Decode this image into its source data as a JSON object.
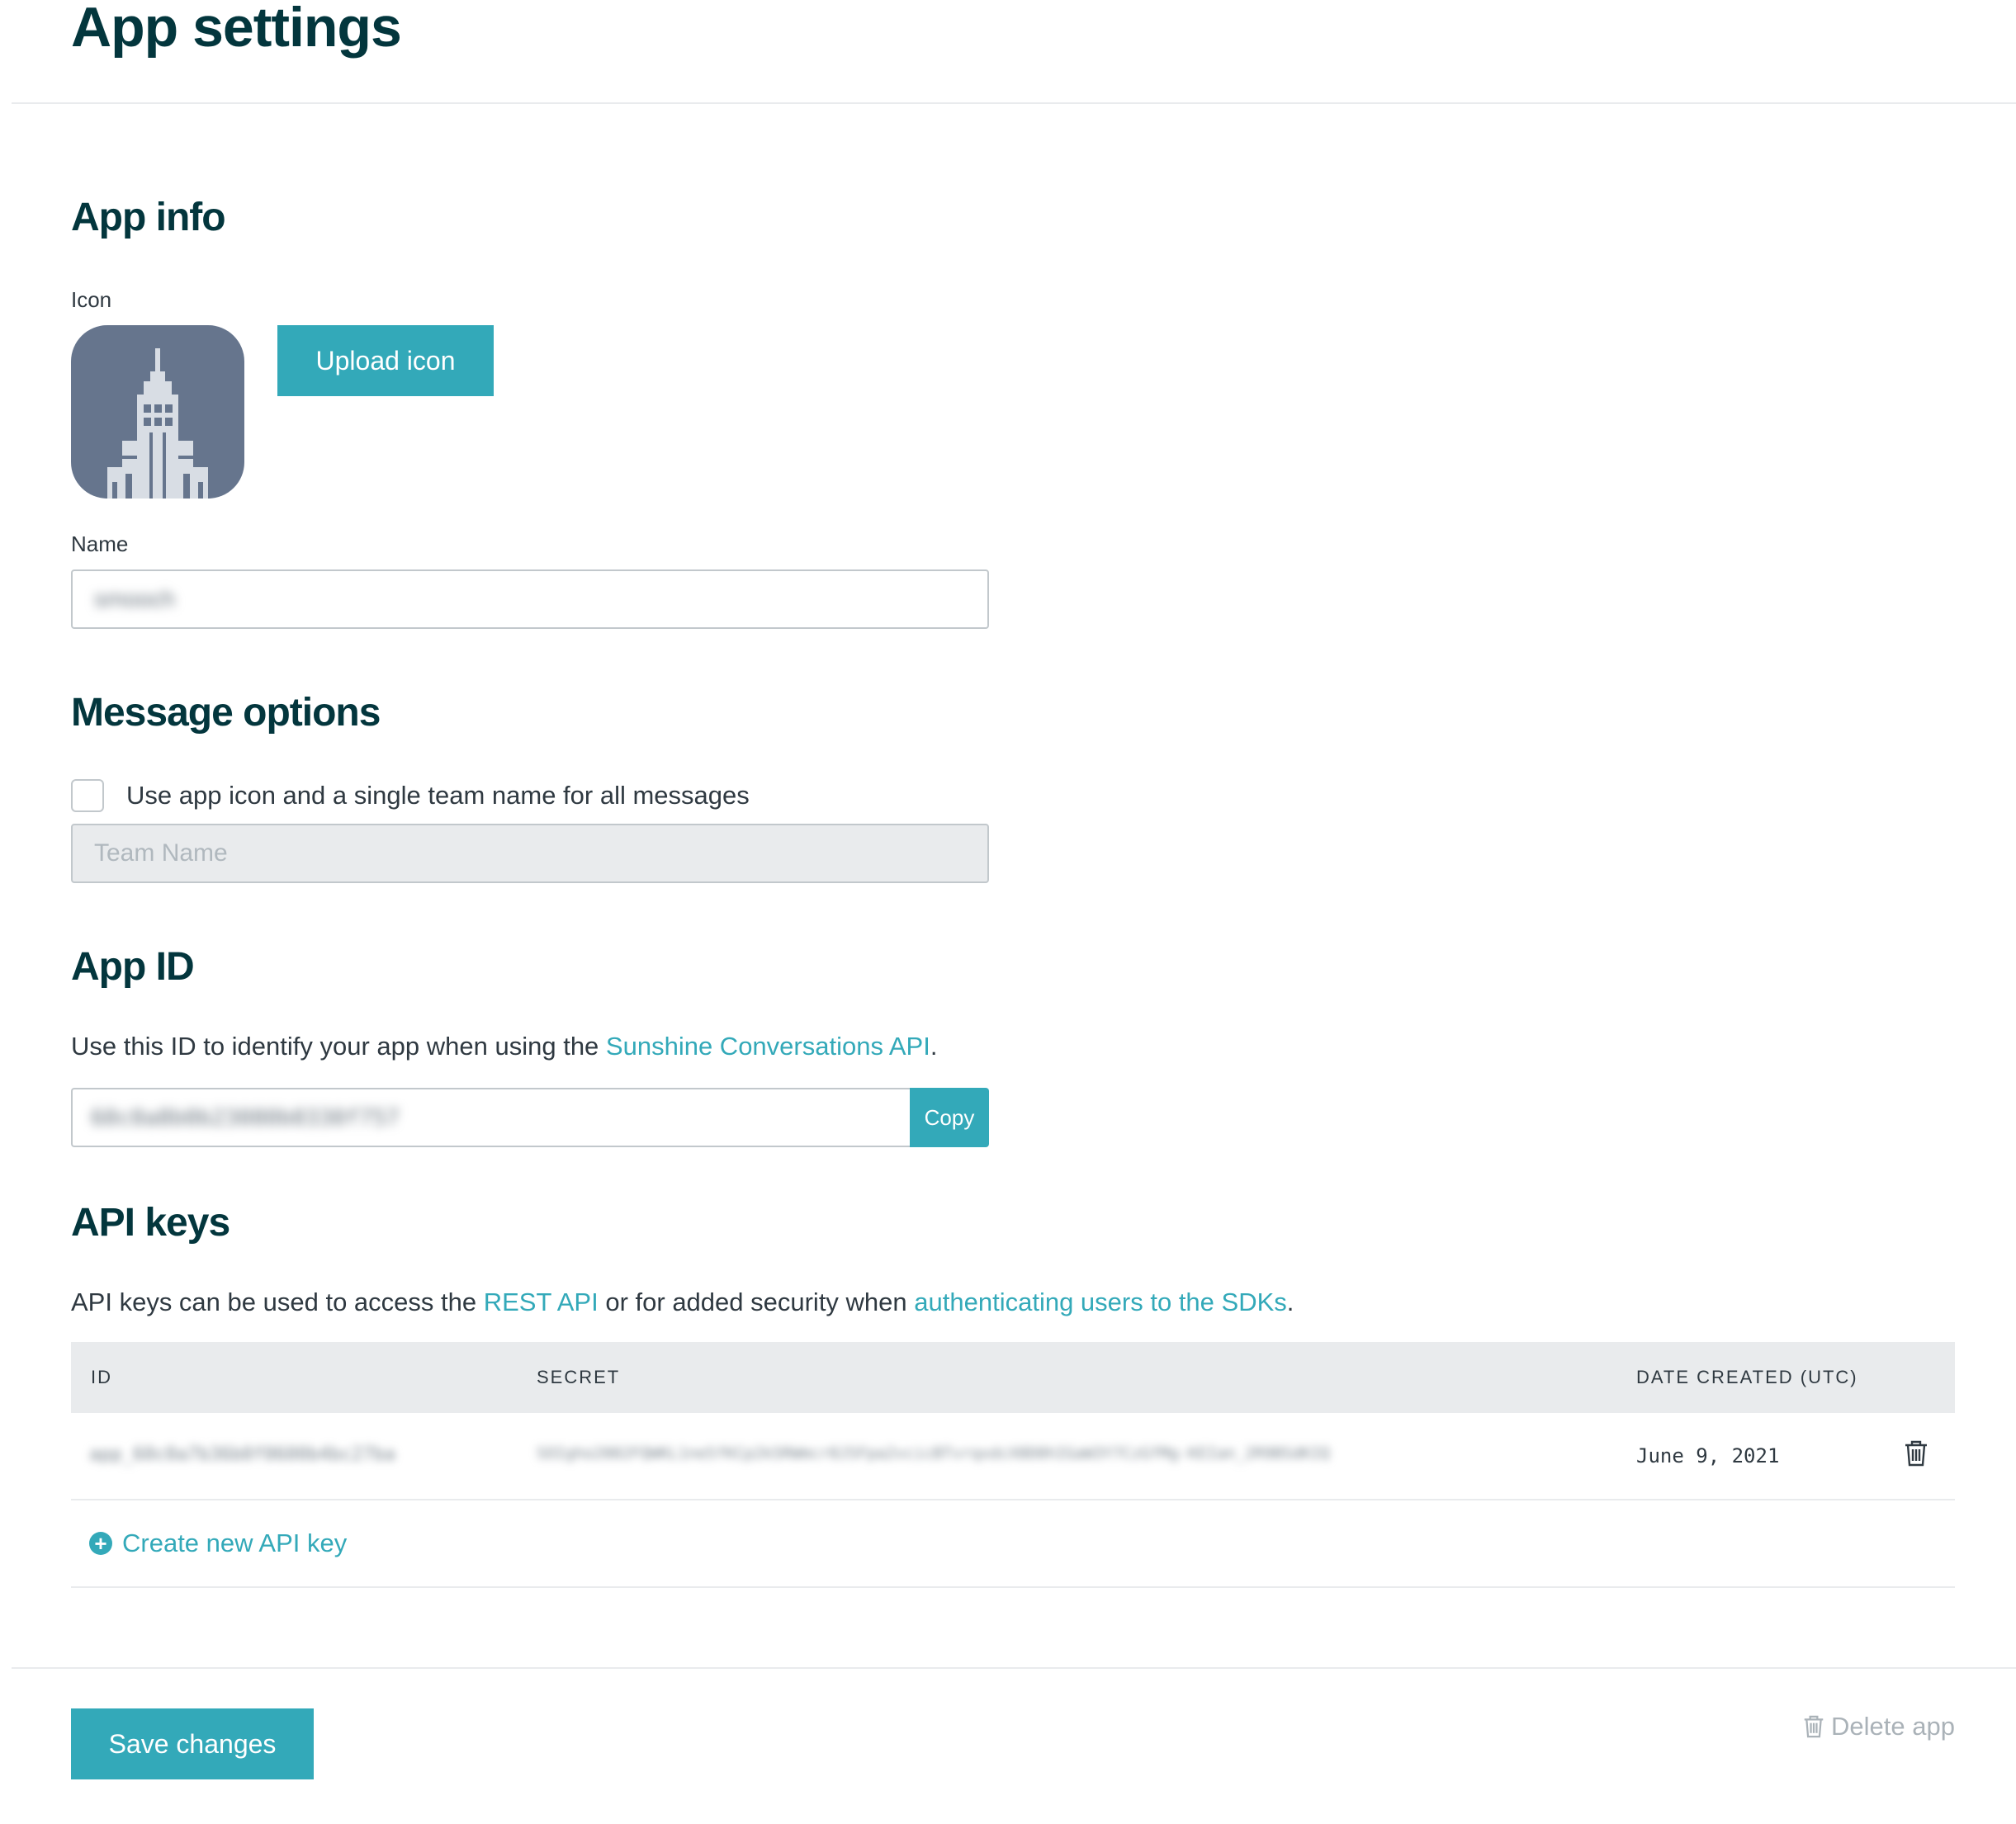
{
  "page_title": "App settings",
  "app_info": {
    "heading": "App info",
    "icon_label": "Icon",
    "upload_label": "Upload icon",
    "name_label": "Name",
    "name_value": "smooch"
  },
  "message_options": {
    "heading": "Message options",
    "checkbox_label": "Use app icon and a single team name for all messages",
    "checked": false,
    "team_name_placeholder": "Team Name"
  },
  "app_id": {
    "heading": "App ID",
    "description_prefix": "Use this ID to identify your app when using the ",
    "description_link": "Sunshine Conversations API",
    "description_suffix": ".",
    "value": "60c0a8b0b23080b0330f757",
    "copy_label": "Copy"
  },
  "api_keys": {
    "heading": "API keys",
    "description_prefix": "API keys can be used to access the ",
    "rest_link": "REST API",
    "description_middle": " or for added security when ",
    "auth_link": "authenticating users to the SDKs",
    "description_suffix": ".",
    "columns": [
      "ID",
      "SECRET",
      "DATE CREATED (UTC)"
    ],
    "rows": [
      {
        "id": "app_60c0a7b36b0f0600b4bc27ba",
        "secret": "SOIgho2002FQWKL1ne5fKCp2k5RWmcr0J5Fpa2vcicBTvrqxdcX0D0hIGaW3Y7CzGfMg-KEIan_2R9BSdKIQ",
        "date": "June 9, 2021"
      }
    ],
    "create_label": "Create new API key"
  },
  "footer": {
    "save_label": "Save changes",
    "delete_label": "Delete app"
  },
  "colors": {
    "accent": "#33a9b9",
    "heading": "#03363d",
    "icon_bg": "#66758d"
  }
}
